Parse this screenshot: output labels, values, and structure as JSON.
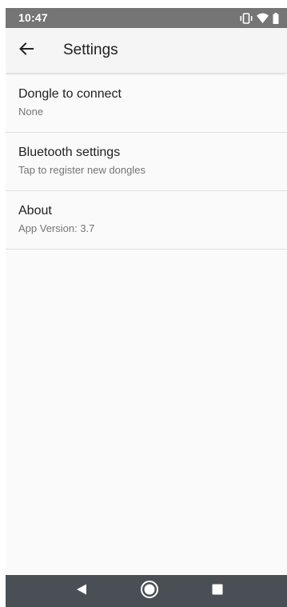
{
  "status_bar": {
    "time": "10:47",
    "icons": [
      "vibrate-icon",
      "wifi-icon",
      "battery-icon"
    ]
  },
  "app_bar": {
    "title": "Settings",
    "back_icon": "arrow-back-icon"
  },
  "preferences": [
    {
      "title": "Dongle to connect",
      "summary": "None"
    },
    {
      "title": "Bluetooth settings",
      "summary": "Tap to register new dongles"
    },
    {
      "title": "About",
      "summary": "App Version: 3.7"
    }
  ],
  "nav_bar": {
    "icons": [
      "nav-back-icon",
      "nav-home-icon",
      "nav-recents-icon"
    ]
  },
  "colors": {
    "status_bar": "#757575",
    "app_bar": "#f5f5f5",
    "background": "#fafafa",
    "nav_bar": "#4a4f55",
    "primary_text": "#212121",
    "secondary_text": "#757575",
    "divider": "#e0e0e0"
  }
}
